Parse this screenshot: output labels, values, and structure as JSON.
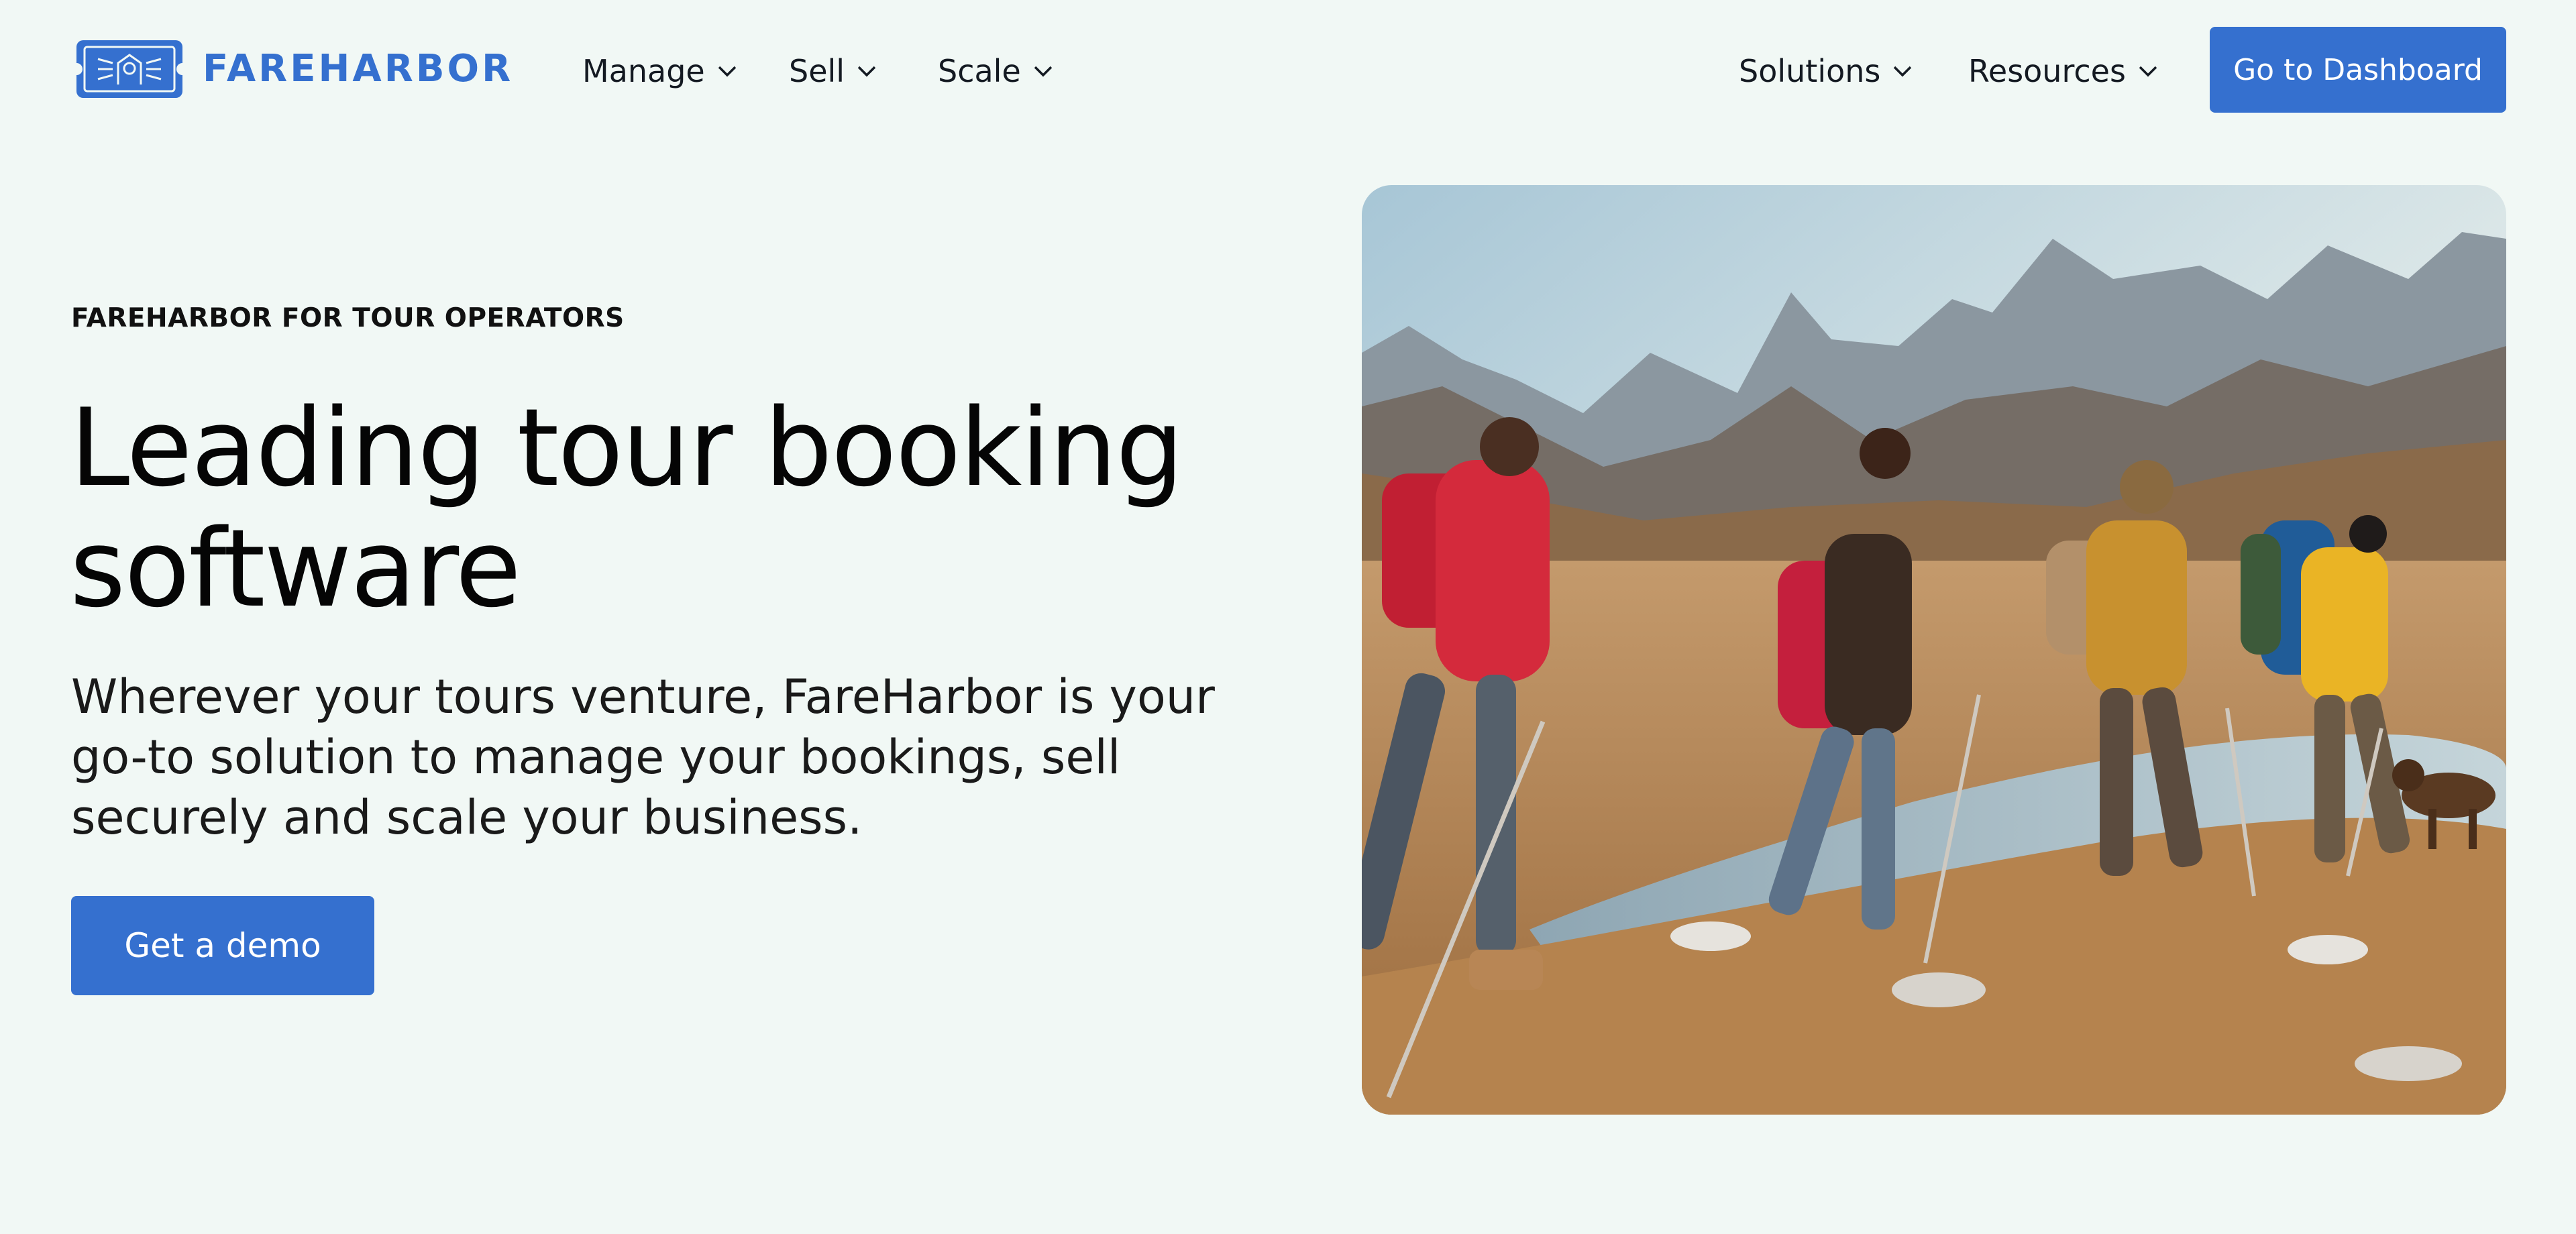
{
  "header": {
    "logo_text": "FAREHARBOR",
    "nav_left": [
      {
        "label": "Manage"
      },
      {
        "label": "Sell"
      },
      {
        "label": "Scale"
      }
    ],
    "nav_right": [
      {
        "label": "Solutions"
      },
      {
        "label": "Resources"
      }
    ],
    "cta_label": "Go to Dashboard"
  },
  "hero": {
    "eyebrow": "FAREHARBOR FOR TOUR OPERATORS",
    "headline_line1": "Leading tour booking",
    "headline_line2": "software",
    "subheadline": "Wherever your tours venture, FareHarbor is your go-to solution to manage your bookings, sell securely and scale your business.",
    "cta_label": "Get a demo",
    "image_subject": "hikers-in-mountains-photo"
  },
  "icons": {
    "logo": "ticket-logo-icon",
    "dropdown": "chevron-down-icon"
  },
  "colors": {
    "brand_blue": "#3570cf",
    "page_background": "#f1f8f5",
    "text_dark": "#0b0b0b"
  }
}
